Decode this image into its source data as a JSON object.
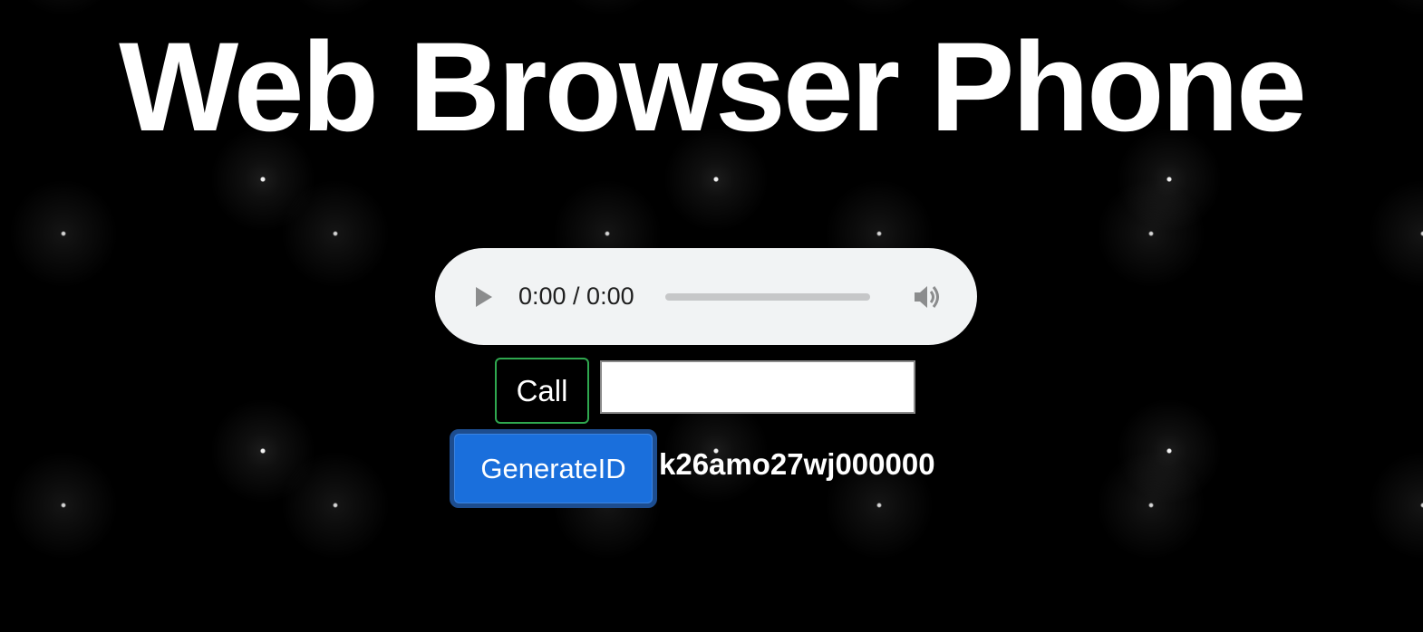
{
  "page": {
    "title": "Web Browser Phone"
  },
  "audio_player": {
    "time": "0:00 / 0:00",
    "progress": 0
  },
  "call": {
    "button_label": "Call",
    "input_value": "",
    "input_placeholder": ""
  },
  "generate": {
    "button_label": "GenerateID",
    "generated_id": "k26amo27wj000000"
  },
  "colors": {
    "background": "#000000",
    "call_border": "#2fa84f",
    "generate_bg": "#1a6fdc",
    "player_bg": "#f1f3f4"
  },
  "icons": {
    "play": "play-icon",
    "volume": "volume-icon"
  }
}
